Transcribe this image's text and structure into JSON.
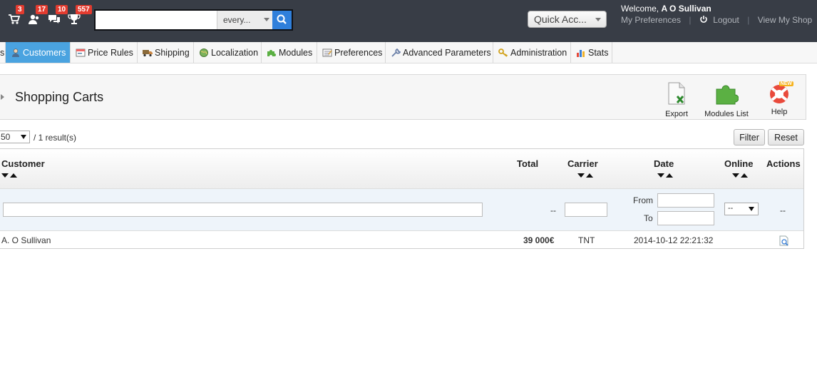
{
  "header": {
    "notifications": [
      {
        "name": "cart-notification",
        "count": "3"
      },
      {
        "name": "customer-notification",
        "count": "17"
      },
      {
        "name": "message-notification",
        "count": "10"
      },
      {
        "name": "trophy-notification",
        "count": "557"
      }
    ],
    "search": {
      "value": "",
      "scope": "every..."
    },
    "quick_access": "Quick Acc...",
    "welcome_prefix": "Welcome,",
    "user_name": "A O Sullivan",
    "links": {
      "preferences": "My Preferences",
      "logout": "Logout",
      "view_shop": "View My Shop"
    }
  },
  "menu": [
    {
      "label": "s",
      "icon": "none"
    },
    {
      "label": "Customers",
      "icon": "customer-icon",
      "active": true
    },
    {
      "label": "Price Rules",
      "icon": "price-rules-icon"
    },
    {
      "label": "Shipping",
      "icon": "truck-icon"
    },
    {
      "label": "Localization",
      "icon": "globe-icon"
    },
    {
      "label": "Modules",
      "icon": "puzzle-icon"
    },
    {
      "label": "Preferences",
      "icon": "preferences-icon"
    },
    {
      "label": "Advanced Parameters",
      "icon": "wrench-icon"
    },
    {
      "label": "Administration",
      "icon": "key-icon"
    },
    {
      "label": "Stats",
      "icon": "stats-icon"
    }
  ],
  "page": {
    "title": "Shopping Carts",
    "toolbar": {
      "export": "Export",
      "modules_list": "Modules List",
      "help": "Help",
      "help_badge": "NEW"
    }
  },
  "list": {
    "per_page": "50",
    "results": "/ 1 result(s)",
    "filter_button": "Filter",
    "reset_button": "Reset",
    "columns": {
      "customer": "Customer",
      "total": "Total",
      "carrier": "Carrier",
      "date": "Date",
      "online": "Online",
      "actions": "Actions"
    },
    "filters": {
      "total": "--",
      "date_from": "From",
      "date_to": "To",
      "online": "--",
      "actions": "--"
    },
    "rows": [
      {
        "customer": "A. O Sullivan",
        "total": "39 000€",
        "carrier": "TNT",
        "date": "2014-10-12 22:21:32"
      }
    ]
  },
  "colors": {
    "topbar": "#383d46",
    "active_tab": "#4aa3e0",
    "badge": "#e33b2f",
    "search_button": "#2f7fdb"
  }
}
